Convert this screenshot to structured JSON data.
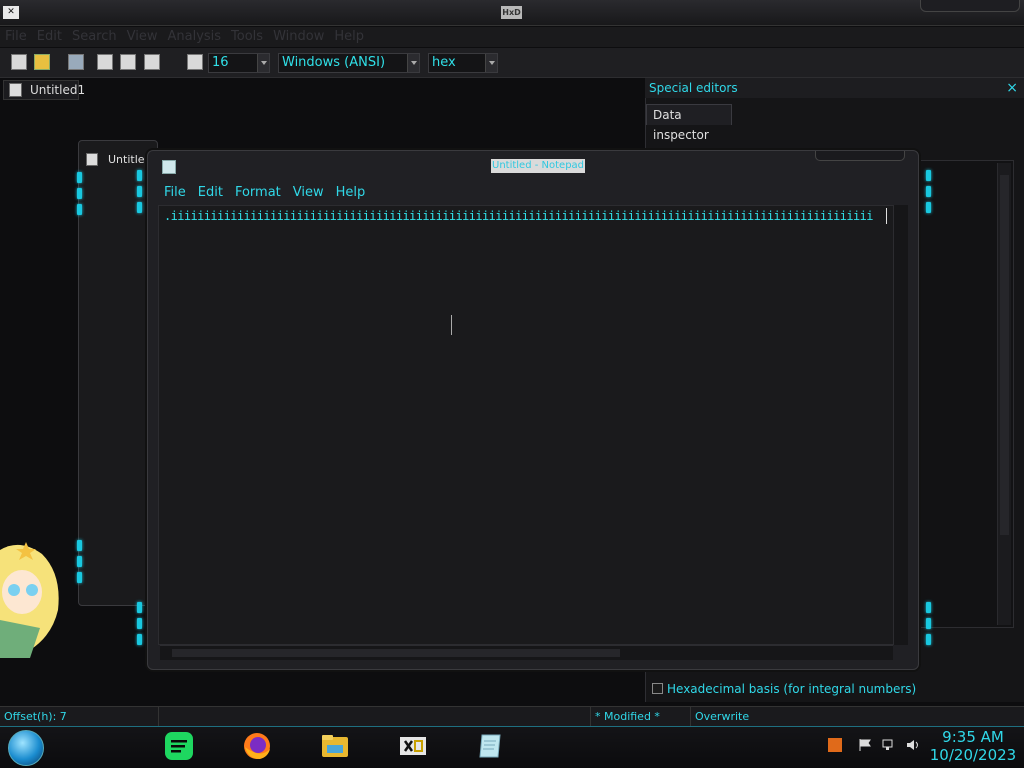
{
  "hxd": {
    "menu": [
      "File",
      "Edit",
      "Search",
      "View",
      "Analysis",
      "Tools",
      "Window",
      "Help"
    ],
    "app_icon_label": "✕",
    "center_icon_label": "HxD",
    "toolbar": {
      "bytes_per_row": "16",
      "charset": "Windows (ANSI)",
      "offset_base": "hex"
    },
    "document_tab": "Untitled1",
    "subwindow_tab": "Untitle",
    "special_editors": {
      "title": "Special editors",
      "close": "×",
      "tab": "Data inspector",
      "hex_basis_label": "Hexadecimal basis (for integral numbers)"
    },
    "status": {
      "offset": "Offset(h): 7",
      "modified": "* Modified *",
      "mode": "Overwrite"
    }
  },
  "notepad": {
    "title": "Untitled - Notepad",
    "menu": [
      "File",
      "Edit",
      "Format",
      "View",
      "Help"
    ],
    "text": ".iiiiiiiiiiiiiiiiiiiiiiiiiiiiiiiiiiiiiiiiiiiiiiiiiiiiiiiiiiiiiiiiiiiiiiiiiiiiiiiiiiiiiiiiiiiiiiiiiiiiiiiiii"
  },
  "taskbar": {
    "time": "9:35 AM",
    "date": "10/20/2023",
    "apps": [
      "spotify-icon",
      "firefox-icon",
      "file-explorer-icon",
      "hxd-icon",
      "notepad-icon"
    ]
  },
  "colors": {
    "accent": "#30d8e8",
    "background": "#0d0d0f",
    "panel": "#1a1a1c"
  }
}
